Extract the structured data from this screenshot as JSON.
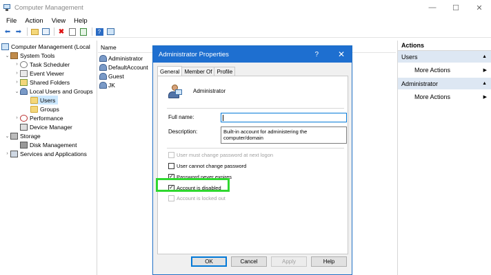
{
  "window": {
    "title": "Computer Management",
    "minimize_icon": "minimize-icon",
    "maximize_icon": "maximize-icon",
    "close_icon": "close-icon"
  },
  "menubar": [
    "File",
    "Action",
    "View",
    "Help"
  ],
  "toolbar": {
    "icons": [
      "back-arrow-icon",
      "forward-arrow-icon",
      "up-folder-icon",
      "show-hide-tree-icon",
      "delete-icon",
      "properties-icon",
      "export-icon",
      "help-icon",
      "toggle-pane-icon"
    ]
  },
  "tree": {
    "root": "Computer Management (Local",
    "system_tools": "System Tools",
    "task_scheduler": "Task Scheduler",
    "event_viewer": "Event Viewer",
    "shared_folders": "Shared Folders",
    "local_users_groups": "Local Users and Groups",
    "users": "Users",
    "groups": "Groups",
    "performance": "Performance",
    "device_manager": "Device Manager",
    "storage": "Storage",
    "disk_management": "Disk Management",
    "services_apps": "Services and Applications"
  },
  "list": {
    "columns": [
      "Name"
    ],
    "rows": [
      "Administrator",
      "DefaultAccount",
      "Guest",
      "JK"
    ]
  },
  "actions": {
    "header": "Actions",
    "sections": [
      {
        "title": "Users",
        "item": "More Actions"
      },
      {
        "title": "Administrator",
        "item": "More Actions"
      }
    ]
  },
  "dialog": {
    "title": "Administrator Properties",
    "help_glyph": "?",
    "close_glyph": "✕",
    "tabs": [
      "General",
      "Member Of",
      "Profile"
    ],
    "active_tab": "General",
    "user_name": "Administrator",
    "full_name_label": "Full name:",
    "full_name_value": "",
    "description_label": "Description:",
    "description_value": "Built-in account for administering the computer/domain",
    "checkboxes": [
      {
        "label": "User must change password at next logon",
        "checked": false,
        "disabled": true
      },
      {
        "label": "User cannot change password",
        "checked": false,
        "disabled": false
      },
      {
        "label": "Password never expires",
        "checked": true,
        "disabled": false
      },
      {
        "label": "Account is disabled",
        "checked": true,
        "disabled": false
      },
      {
        "label": "Account is locked out",
        "checked": false,
        "disabled": true
      }
    ],
    "buttons": {
      "ok": "OK",
      "cancel": "Cancel",
      "apply": "Apply",
      "help": "Help"
    },
    "highlight_color": "#2fd82f",
    "titlebar_color": "#1e6fd0"
  }
}
